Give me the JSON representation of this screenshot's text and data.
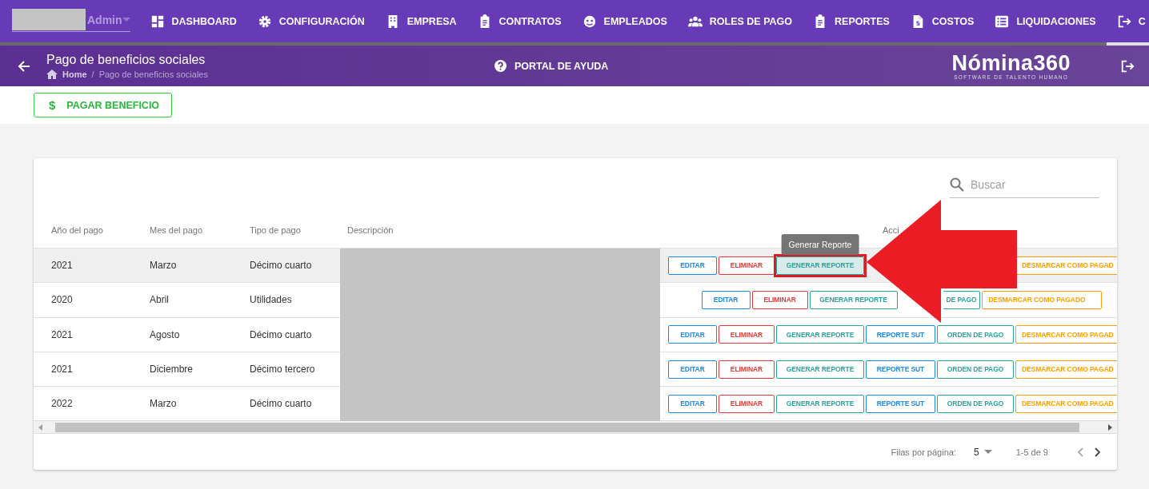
{
  "user_menu": {
    "role": "Admin"
  },
  "nav": [
    {
      "label": "DASHBOARD",
      "selected": false
    },
    {
      "label": "CONFIGURACIÓN",
      "selected": false
    },
    {
      "label": "EMPRESA",
      "selected": false
    },
    {
      "label": "CONTRATOS",
      "selected": false
    },
    {
      "label": "EMPLEADOS",
      "selected": false
    },
    {
      "label": "ROLES DE PAGO",
      "selected": false
    },
    {
      "label": "REPORTES",
      "selected": false
    },
    {
      "label": "COSTOS",
      "selected": false
    },
    {
      "label": "LIQUIDACIONES",
      "selected": false
    },
    {
      "label": "C",
      "selected": true
    }
  ],
  "page_header": {
    "title": "Pago de beneficios sociales",
    "breadcrumb": [
      "Home",
      "/",
      "Pago de beneficios sociales"
    ],
    "help": "PORTAL DE AYUDA",
    "logo": "Nómina360",
    "logo_tagline": "SOFTWARE DE TALENTO HUMANO"
  },
  "primary_action": {
    "icon": "$",
    "label": "PAGAR BENEFICIO"
  },
  "search": {
    "placeholder": "Buscar"
  },
  "columns": [
    "Año del pago",
    "Mes del pago",
    "Tipo de pago",
    "Descripción",
    "Acci"
  ],
  "rows": [
    {
      "year": "2021",
      "month": "Marzo",
      "type": "Décimo cuarto",
      "hovered": true,
      "actions": [
        {
          "kind": "edit",
          "label": "EDITAR"
        },
        {
          "kind": "delete",
          "label": "ELIMINAR"
        },
        {
          "kind": "report",
          "label": "GENERAR REPORTE",
          "hovered": true,
          "tooltip": "Generar Reporte"
        },
        {
          "kind": "sut"
        },
        {
          "kind": "order"
        },
        {
          "kind": "unmark",
          "label": "DESMARCAR COMO PAGAD"
        }
      ]
    },
    {
      "year": "2020",
      "month": "Abril",
      "type": "Utilidades",
      "hovered": false,
      "actions": [
        {
          "kind": "edit",
          "label": "EDITAR"
        },
        {
          "kind": "delete",
          "label": "ELIMINAR"
        },
        {
          "kind": "report",
          "label": "GENERAR REPORTE"
        },
        {
          "kind": "ordertail",
          "label": "DE PAGO"
        },
        {
          "kind": "unmark",
          "label": "DESMARCAR COMO PAGADO"
        }
      ]
    },
    {
      "year": "2021",
      "month": "Agosto",
      "type": "Décimo cuarto",
      "hovered": false,
      "actions": [
        {
          "kind": "edit",
          "label": "EDITAR"
        },
        {
          "kind": "delete",
          "label": "ELIMINAR"
        },
        {
          "kind": "report",
          "label": "GENERAR REPORTE"
        },
        {
          "kind": "sut",
          "label": "REPORTE SUT"
        },
        {
          "kind": "order",
          "label": "ORDEN DE PAGO"
        },
        {
          "kind": "unmark",
          "label": "DESMARCAR COMO PAGAD"
        }
      ]
    },
    {
      "year": "2021",
      "month": "Diciembre",
      "type": "Décimo tercero",
      "hovered": false,
      "actions": [
        {
          "kind": "edit",
          "label": "EDITAR"
        },
        {
          "kind": "delete",
          "label": "ELIMINAR"
        },
        {
          "kind": "report",
          "label": "GENERAR REPORTE"
        },
        {
          "kind": "sut",
          "label": "REPORTE SUT"
        },
        {
          "kind": "order",
          "label": "ORDEN DE PAGO"
        },
        {
          "kind": "unmark",
          "label": "DESMARCAR COMO PAGAD"
        }
      ]
    },
    {
      "year": "2022",
      "month": "Marzo",
      "type": "Décimo cuarto",
      "hovered": false,
      "actions": [
        {
          "kind": "edit",
          "label": "EDITAR"
        },
        {
          "kind": "delete",
          "label": "ELIMINAR"
        },
        {
          "kind": "report",
          "label": "GENERAR REPORTE"
        },
        {
          "kind": "sut",
          "label": "REPORTE SUT"
        },
        {
          "kind": "order",
          "label": "ORDEN DE PAGO"
        },
        {
          "kind": "unmark",
          "label": "DESMARCAR COMO PAGAD"
        }
      ]
    }
  ],
  "pagination": {
    "rows_label": "Filas por página:",
    "rows_per_page": "5",
    "range": "1-5 de 9"
  }
}
